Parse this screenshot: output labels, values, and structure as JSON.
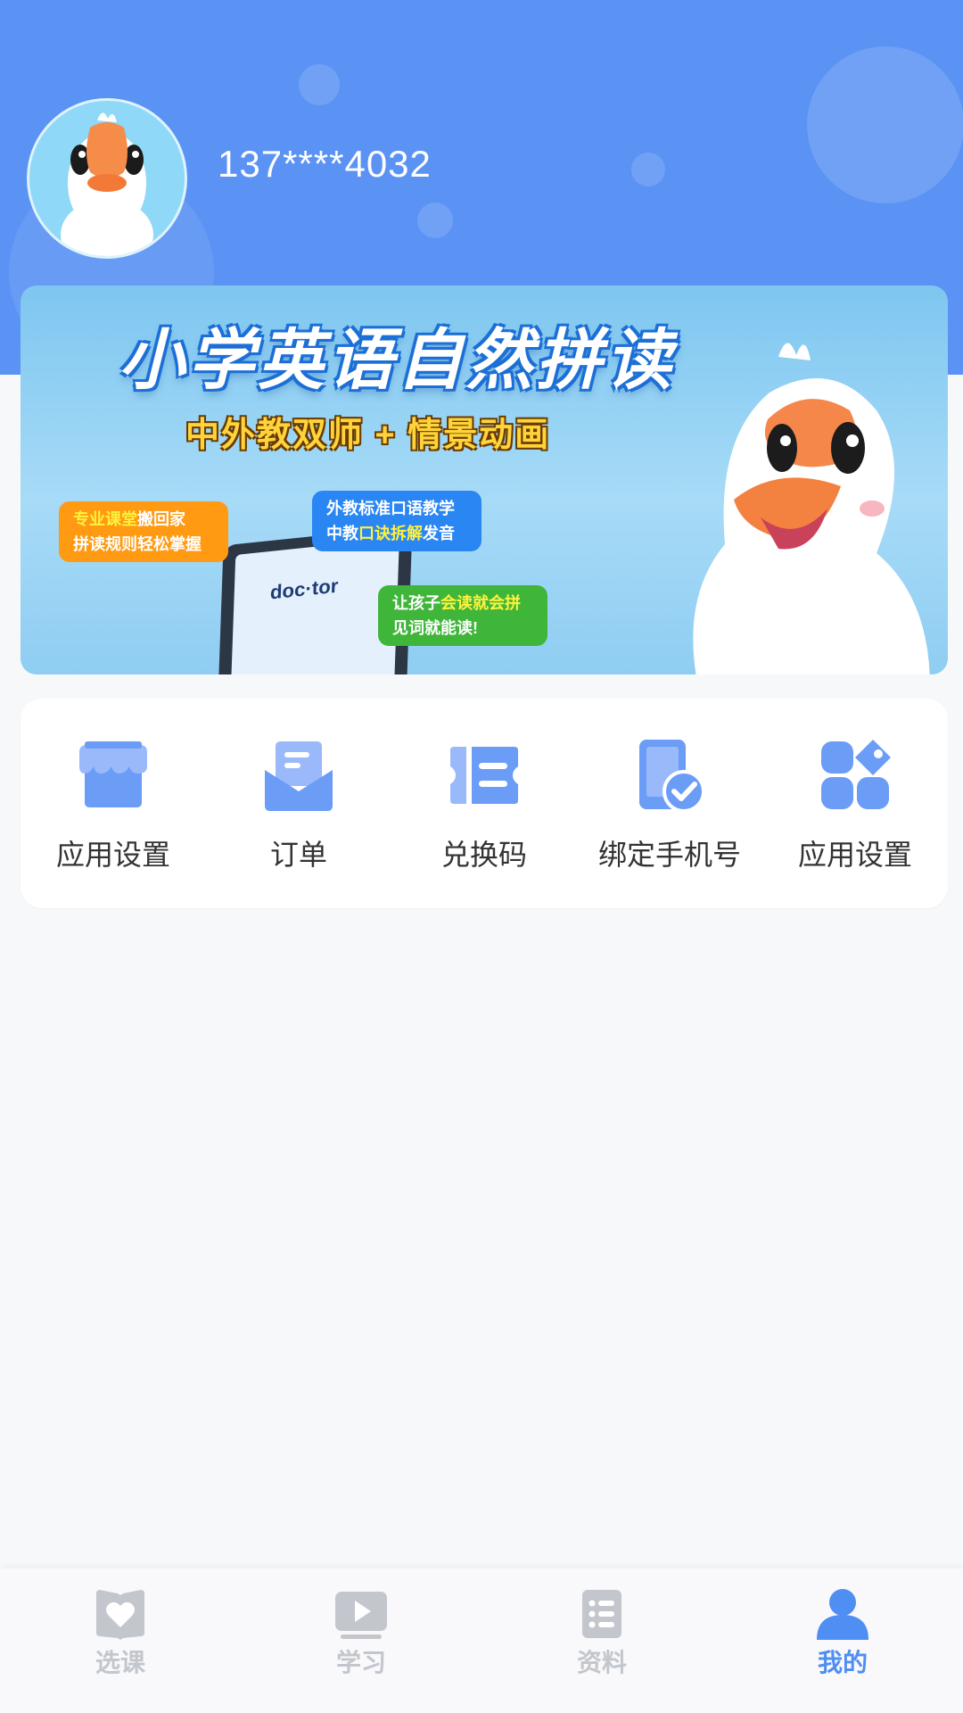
{
  "header": {
    "phone": "137****4032",
    "avatar_icon": "goose-avatar-icon",
    "bg_color": "#5b93f4"
  },
  "banner": {
    "title": "小学英语自然拼读",
    "subtitle": "中外教双师 + 情景动画",
    "tag_orange": {
      "hl": "专业课堂",
      "rest": "搬回家",
      "line2": "拼读规则轻松掌握"
    },
    "tag_blue": {
      "line1": "外教标准口语教学",
      "pre": "中教",
      "hl": "口诀拆解",
      "post": "发音"
    },
    "tag_green": {
      "pre": "让孩子",
      "hl": "会读就会拼",
      "line2": "见词就能读!"
    },
    "tablet_word": "doc·tor"
  },
  "menu": {
    "items": [
      {
        "label": "应用设置",
        "icon": "shop-icon"
      },
      {
        "label": "订单",
        "icon": "order-envelope-icon"
      },
      {
        "label": "兑换码",
        "icon": "ticket-icon"
      },
      {
        "label": "绑定手机号",
        "icon": "phone-check-icon"
      },
      {
        "label": "应用设置",
        "icon": "apps-grid-icon"
      }
    ]
  },
  "bottom_nav": {
    "items": [
      {
        "label": "选课",
        "icon": "book-heart-icon",
        "active": false
      },
      {
        "label": "学习",
        "icon": "play-icon",
        "active": false
      },
      {
        "label": "资料",
        "icon": "list-icon",
        "active": false
      },
      {
        "label": "我的",
        "icon": "person-icon",
        "active": true
      }
    ],
    "active_color": "#4f8ef2",
    "inactive_color": "#c3c6cc"
  }
}
